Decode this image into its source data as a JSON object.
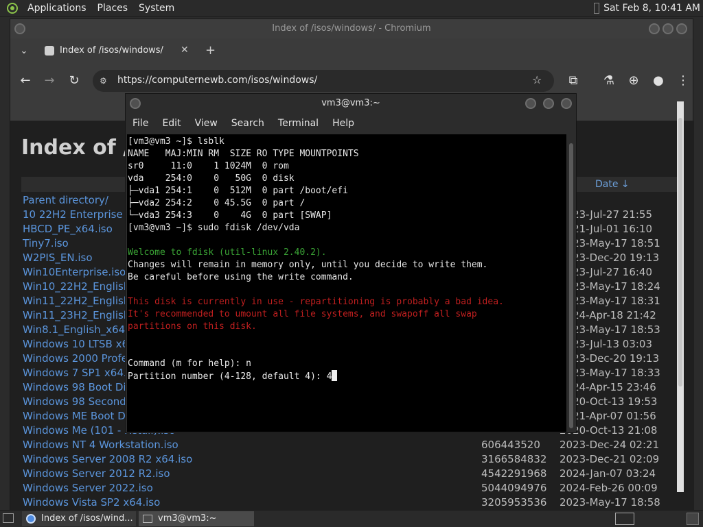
{
  "top_panel": {
    "menu": [
      "Applications",
      "Places",
      "System"
    ],
    "clock": "Sat Feb  8, 10:41 AM"
  },
  "browser": {
    "window_title": "Index of /isos/windows/ - Chromium",
    "tab_title": "Index of /isos/windows/",
    "url": "https://computernewb.com/isos/windows/",
    "page_title": "Index of /isos/windows/",
    "date_header": "Date ↓",
    "rows": [
      {
        "name": "Parent directory/",
        "size": "",
        "date": ""
      },
      {
        "name": "10 22H2 Enterprise x64.iso",
        "size": "",
        "date": "2023-Jul-27 21:55"
      },
      {
        "name": "HBCD_PE_x64.iso",
        "size": "",
        "date": "2021-Jul-01 16:10"
      },
      {
        "name": "Tiny7.iso",
        "size": "",
        "date": "2023-May-17 18:51"
      },
      {
        "name": "W2PIS_EN.iso",
        "size": "",
        "date": "2023-Dec-20 19:13"
      },
      {
        "name": "Win10Enterprise.iso",
        "size": "",
        "date": "2023-Jul-27 16:40"
      },
      {
        "name": "Win10_22H2_English_x64.iso",
        "size": "",
        "date": "2023-May-17 18:24"
      },
      {
        "name": "Win11_22H2_English_x64.iso",
        "size": "",
        "date": "2023-May-17 18:31"
      },
      {
        "name": "Win11_23H2_English_x64.iso",
        "size": "",
        "date": "2024-Apr-18 21:42"
      },
      {
        "name": "Win8.1_English_x64.iso",
        "size": "",
        "date": "2023-May-17 18:53"
      },
      {
        "name": "Windows 10 LTSB x64.iso",
        "size": "",
        "date": "2023-Jul-13 03:03"
      },
      {
        "name": "Windows 2000 Professional.iso",
        "size": "",
        "date": "2023-Dec-20 19:13"
      },
      {
        "name": "Windows 7 SP1 x64.iso",
        "size": "",
        "date": "2023-May-17 18:33"
      },
      {
        "name": "Windows 98 Boot Disk.iso",
        "size": "",
        "date": "2024-Apr-15 23:46"
      },
      {
        "name": "Windows 98 Second Edition.iso",
        "size": "",
        "date": "2020-Oct-13 19:53"
      },
      {
        "name": "Windows ME Boot Disk.iso",
        "size": "",
        "date": "2021-Apr-07 01:56"
      },
      {
        "name": "Windows Me (101 - Retail).iso",
        "size": "",
        "date": "2020-Oct-13 21:08"
      },
      {
        "name": "Windows NT 4 Workstation.iso",
        "size": "606443520",
        "date": "2023-Dec-24 02:21"
      },
      {
        "name": "Windows Server 2008 R2 x64.iso",
        "size": "3166584832",
        "date": "2023-Dec-21 02:09"
      },
      {
        "name": "Windows Server 2012 R2.iso",
        "size": "4542291968",
        "date": "2024-Jan-07 03:24"
      },
      {
        "name": "Windows Server 2022.iso",
        "size": "5044094976",
        "date": "2024-Feb-26 00:09"
      },
      {
        "name": "Windows Vista SP2 x64.iso",
        "size": "3205953536",
        "date": "2023-May-17 18:58"
      }
    ]
  },
  "terminal": {
    "title": "vm3@vm3:~",
    "menu": [
      "File",
      "Edit",
      "View",
      "Search",
      "Terminal",
      "Help"
    ],
    "lines": [
      {
        "text": "[vm3@vm3 ~]$ lsblk",
        "color": "#e8e8e8"
      },
      {
        "text": "NAME   MAJ:MIN RM  SIZE RO TYPE MOUNTPOINTS",
        "color": "#e8e8e8"
      },
      {
        "text": "sr0     11:0    1 1024M  0 rom",
        "color": "#e8e8e8"
      },
      {
        "text": "vda    254:0    0   50G  0 disk",
        "color": "#e8e8e8"
      },
      {
        "text": "├─vda1 254:1    0  512M  0 part /boot/efi",
        "color": "#e8e8e8"
      },
      {
        "text": "├─vda2 254:2    0 45.5G  0 part /",
        "color": "#e8e8e8"
      },
      {
        "text": "└─vda3 254:3    0    4G  0 part [SWAP]",
        "color": "#e8e8e8"
      },
      {
        "text": "[vm3@vm3 ~]$ sudo fdisk /dev/vda",
        "color": "#e8e8e8"
      },
      {
        "text": "",
        "color": "#e8e8e8"
      },
      {
        "text": "Welcome to fdisk (util-linux 2.40.2).",
        "color": "#3aa335"
      },
      {
        "text": "Changes will remain in memory only, until you decide to write them.",
        "color": "#e8e8e8"
      },
      {
        "text": "Be careful before using the write command.",
        "color": "#e8e8e8"
      },
      {
        "text": "",
        "color": "#e8e8e8"
      },
      {
        "text": "This disk is currently in use - repartitioning is probably a bad idea.",
        "color": "#c01f1f"
      },
      {
        "text": "It's recommended to umount all file systems, and swapoff all swap",
        "color": "#c01f1f"
      },
      {
        "text": "partitions on this disk.",
        "color": "#c01f1f"
      },
      {
        "text": "",
        "color": "#e8e8e8"
      },
      {
        "text": "",
        "color": "#e8e8e8"
      },
      {
        "text": "Command (m for help): n",
        "color": "#e8e8e8"
      },
      {
        "text": "Partition number (4-128, default 4): 4",
        "color": "#e8e8e8"
      }
    ]
  },
  "taskbar": {
    "items": [
      "Index of /isos/wind...",
      "vm3@vm3:~"
    ]
  }
}
